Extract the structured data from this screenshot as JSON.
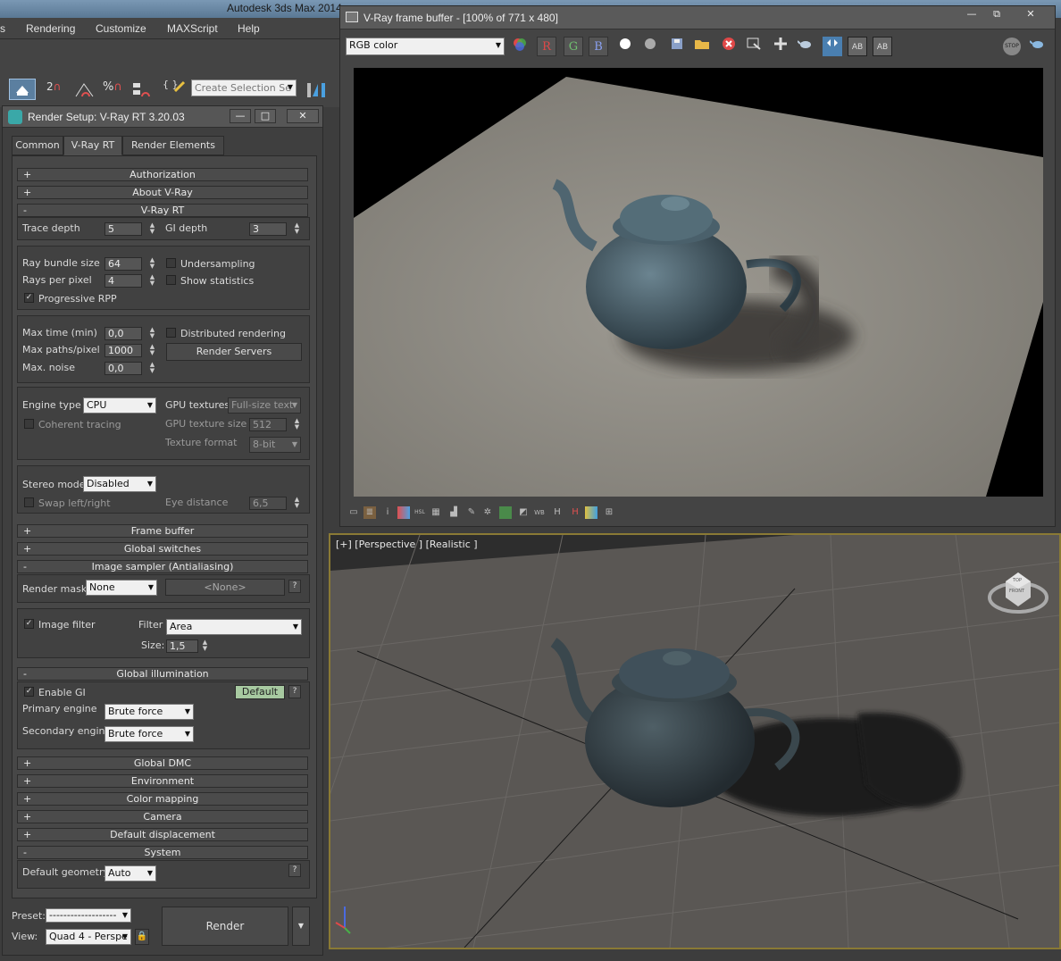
{
  "main": {
    "title": "Autodesk 3ds Max  2014",
    "menus": [
      "s",
      "Rendering",
      "Customize",
      "MAXScript",
      "Help"
    ],
    "toolbar_icons": [
      "select-object-icon",
      "snap-2d-icon",
      "angle-snap-icon",
      "percent-snap-icon",
      "spinner-snap-icon",
      "edit-named-sets-icon"
    ],
    "toolbar_texts": [
      "2",
      "",
      "%",
      "",
      "{ }"
    ],
    "selection_set_placeholder": "Create Selection Se"
  },
  "render_setup": {
    "title": "Render Setup: V-Ray RT 3.20.03",
    "tabs": [
      "Common",
      "V-Ray RT",
      "Render Elements"
    ],
    "active_tab": "V-Ray RT",
    "rollouts": {
      "authorization": "Authorization",
      "about": "About V-Ray",
      "vrayrt": "V-Ray RT",
      "frame_buffer": "Frame buffer",
      "global_switches": "Global switches",
      "image_sampler": "Image sampler (Antialiasing)",
      "global_illumination": "Global illumination",
      "global_dmc": "Global DMC",
      "environment": "Environment",
      "color_mapping": "Color mapping",
      "camera": "Camera",
      "default_displacement": "Default displacement",
      "system": "System"
    },
    "fields": {
      "trace_depth_label": "Trace depth",
      "trace_depth": "5",
      "gi_depth_label": "GI depth",
      "gi_depth": "3",
      "ray_bundle_label": "Ray bundle size",
      "ray_bundle": "64",
      "rays_per_pixel_label": "Rays per pixel",
      "rays_per_pixel": "4",
      "undersampling_label": "Undersampling",
      "show_statistics_label": "Show statistics",
      "progressive_label": "Progressive RPP",
      "max_time_label": "Max time (min)",
      "max_time": "0,0",
      "max_paths_label": "Max paths/pixel",
      "max_paths": "1000",
      "max_noise_label": "Max. noise",
      "max_noise": "0,0",
      "distributed_label": "Distributed rendering",
      "render_servers": "Render Servers",
      "engine_type_label": "Engine type",
      "engine_type": "CPU",
      "gpu_textures_label": "GPU textures",
      "gpu_textures": "Full-size text",
      "coherent_label": "Coherent tracing",
      "gpu_texture_size_label": "GPU texture size",
      "gpu_texture_size": "512",
      "texture_format_label": "Texture format",
      "texture_format": "8-bit",
      "stereo_mode_label": "Stereo mode",
      "stereo_mode": "Disabled",
      "swap_label": "Swap left/right",
      "eye_distance_label": "Eye distance",
      "eye_distance": "6,5",
      "render_mask_label": "Render mask",
      "render_mask": "None",
      "render_mask_obj": "<None>",
      "image_filter_label": "Image filter",
      "filter_label": "Filter",
      "filter": "Area",
      "size_label": "Size:",
      "size": "1,5",
      "enable_gi_label": "Enable GI",
      "default_button": "Default",
      "primary_label": "Primary engine",
      "primary": "Brute force",
      "secondary_label": "Secondary engine",
      "secondary": "Brute force",
      "default_geometry_label": "Default geometry",
      "default_geometry": "Auto"
    },
    "bottom": {
      "preset_label": "Preset:",
      "preset": "-------------------",
      "view_label": "View:",
      "view": "Quad 4 - Perspe",
      "render_button": "Render"
    }
  },
  "vfb": {
    "title": "V-Ray frame buffer - [100% of 771 x 480]",
    "channel": "RGB color",
    "rgb_buttons": [
      "R",
      "G",
      "B"
    ],
    "toolbar_icons": [
      "color-channels-icon",
      "white-dot-icon",
      "gray-dot-icon",
      "save-icon",
      "open-icon",
      "clear-icon",
      "track-mouse-icon",
      "region-icon",
      "teapot-render-icon",
      "compare-ab-icon",
      "history-a-icon",
      "history-b-icon",
      "stop-icon",
      "render-teapot-icon"
    ],
    "stop_text": "STOP",
    "status_icons": [
      "display-icon",
      "history-icon",
      "info-icon",
      "levels-icon",
      "lut-icon",
      "curves-icon",
      "exposure-icon",
      "lens-icon",
      "tonemap-icon",
      "white-balance-icon",
      "pixel-aspect-icon",
      "ocio-icon",
      "hist-h-icon",
      "sRGB-icon"
    ],
    "status_texts": [
      "",
      "",
      "i",
      "",
      "HSL",
      "",
      "",
      "",
      "",
      "",
      "",
      "",
      "",
      "WB",
      "H",
      "H",
      "",
      ""
    ]
  },
  "viewport": {
    "label": "[+] [Perspective ] [Realistic ]",
    "viewcube_texts": [
      "FRONT",
      "TOP"
    ]
  },
  "colors": {
    "accent": "#8a7a35",
    "default_btn": "#a7c9a0"
  }
}
